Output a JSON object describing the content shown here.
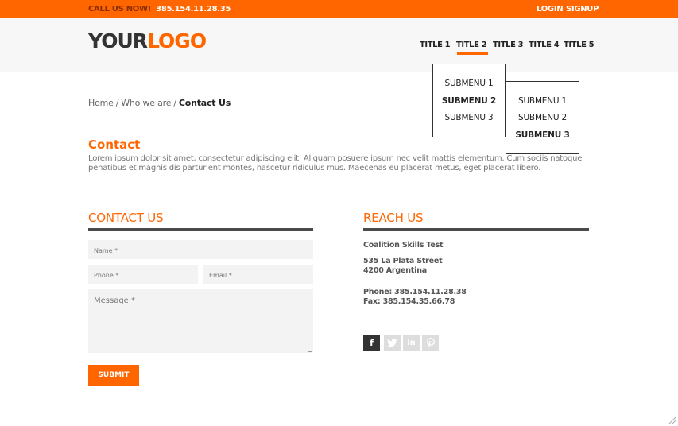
{
  "topbar": {
    "call_label": "CALL US NOW!",
    "phone": "385.154.11.28.35",
    "login": "LOGIN",
    "signup": "SIGNUP"
  },
  "logo": {
    "part1": "YOUR",
    "part2": "LOGO"
  },
  "nav": [
    {
      "label": "TITLE 1"
    },
    {
      "label": "TITLE 2"
    },
    {
      "label": "TITLE 3"
    },
    {
      "label": "TITLE 4"
    },
    {
      "label": "TITLE 5"
    }
  ],
  "submenu1": [
    "SUBMENU 1",
    "SUBMENU 2",
    "SUBMENU 3"
  ],
  "submenu2": [
    "SUBMENU 1",
    "SUBMENU 2",
    "SUBMENU 3"
  ],
  "breadcrumb": {
    "home": "Home",
    "sep1": "/",
    "who": "Who we are",
    "sep2": "/",
    "current": "Contact Us"
  },
  "intro": {
    "title": "Contact",
    "text": "Lorem ipsum dolor sit amet, consectetur adipiscing elit. Aliquam posuere ipsum nec velit mattis elementum. Cum sociis natoque penatibus et magnis dis parturient montes, nascetur ridiculus mus. Maecenas eu placerat metus, eget placerat libero."
  },
  "form": {
    "title": "CONTACT US",
    "name_placeholder": "Name *",
    "phone_placeholder": "Phone *",
    "email_placeholder": "Email *",
    "message_placeholder": "Message *",
    "submit": "SUBMIT"
  },
  "reach": {
    "title": "REACH US",
    "company": "Coalition Skills Test",
    "address1": "535 La Plata Street",
    "address2": "4200 Argentina",
    "phone": "Phone: 385.154.11.28.38",
    "fax": "Fax: 385.154.35.66.78"
  },
  "social": [
    {
      "icon": "facebook-icon",
      "glyph": "f"
    },
    {
      "icon": "twitter-icon",
      "glyph": "t"
    },
    {
      "icon": "linkedin-icon",
      "glyph": "in"
    },
    {
      "icon": "pinterest-icon",
      "glyph": "p"
    }
  ],
  "colors": {
    "accent": "#ff6600",
    "dark": "#333333"
  }
}
